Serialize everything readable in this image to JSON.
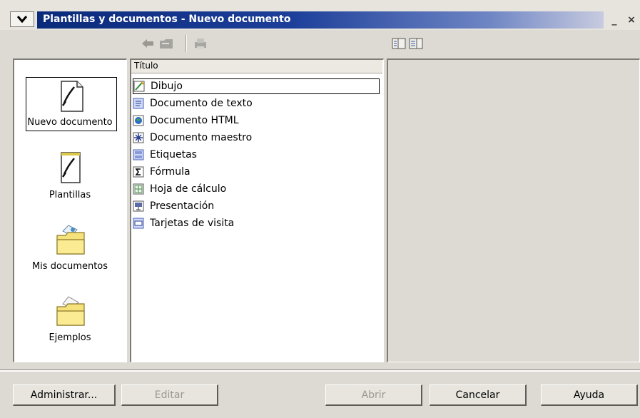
{
  "window": {
    "title": "Plantillas y documentos - Nuevo documento",
    "minimize": "_",
    "close": "×"
  },
  "toolbar": {
    "icons": [
      "back-arrow-icon",
      "folder-up-icon",
      "print-icon",
      "preview-icon",
      "details-icon"
    ]
  },
  "categories": [
    {
      "label": "Nuevo documento",
      "icon": "new-document-icon",
      "selected": true
    },
    {
      "label": "Plantillas",
      "icon": "templates-icon"
    },
    {
      "label": "Mis documentos",
      "icon": "my-documents-folder-icon"
    },
    {
      "label": "Ejemplos",
      "icon": "examples-folder-icon"
    }
  ],
  "list": {
    "header": "Título",
    "items": [
      {
        "label": "Dibujo",
        "icon": "drawing-icon",
        "selected": true
      },
      {
        "label": "Documento de texto",
        "icon": "text-document-icon"
      },
      {
        "label": "Documento HTML",
        "icon": "html-document-icon"
      },
      {
        "label": "Documento maestro",
        "icon": "master-document-icon"
      },
      {
        "label": "Etiquetas",
        "icon": "labels-icon"
      },
      {
        "label": "Fórmula",
        "icon": "formula-icon"
      },
      {
        "label": "Hoja de cálculo",
        "icon": "spreadsheet-icon"
      },
      {
        "label": "Presentación",
        "icon": "presentation-icon"
      },
      {
        "label": "Tarjetas de visita",
        "icon": "business-cards-icon"
      }
    ]
  },
  "buttons": {
    "administrar": "Administrar...",
    "editar": "Editar",
    "abrir": "Abrir",
    "cancelar": "Cancelar",
    "ayuda": "Ayuda"
  }
}
